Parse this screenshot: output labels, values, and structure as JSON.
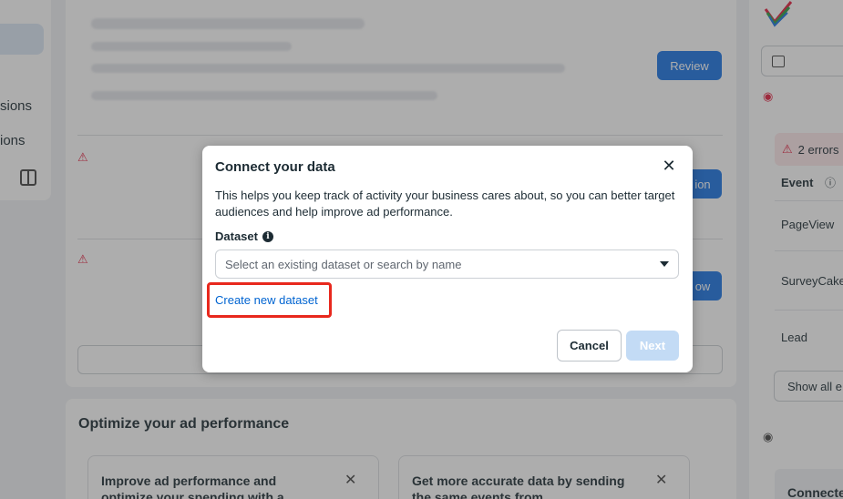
{
  "background": {
    "nav_items": [
      "sions",
      "ions"
    ],
    "review_button": "Review",
    "side_buttons": [
      "ion",
      "ow"
    ],
    "optimize_title": "Optimize your ad performance",
    "tips": [
      {
        "text": "Improve ad performance and optimize your spending with a"
      },
      {
        "text": "Get more accurate data by sending the same events from"
      }
    ],
    "right_panel": {
      "errors_badge": "2 errors",
      "event_header": "Event",
      "events": [
        "PageView",
        "SurveyCake",
        "Lead"
      ],
      "show_all": "Show all e",
      "connected": "Connecte"
    }
  },
  "modal": {
    "title": "Connect your data",
    "description": "This helps you keep track of activity your business cares about, so you can better target audiences and help improve ad performance.",
    "dataset_label": "Dataset",
    "dataset_placeholder": "Select an existing dataset or search by name",
    "create_link": "Create new dataset",
    "cancel_label": "Cancel",
    "next_label": "Next"
  },
  "colors": {
    "accent": "#1b74e4",
    "link": "#0064d1",
    "highlight": "#e8281d",
    "disabled_button": "#c3dbf5",
    "warning": "#e41e3f"
  }
}
